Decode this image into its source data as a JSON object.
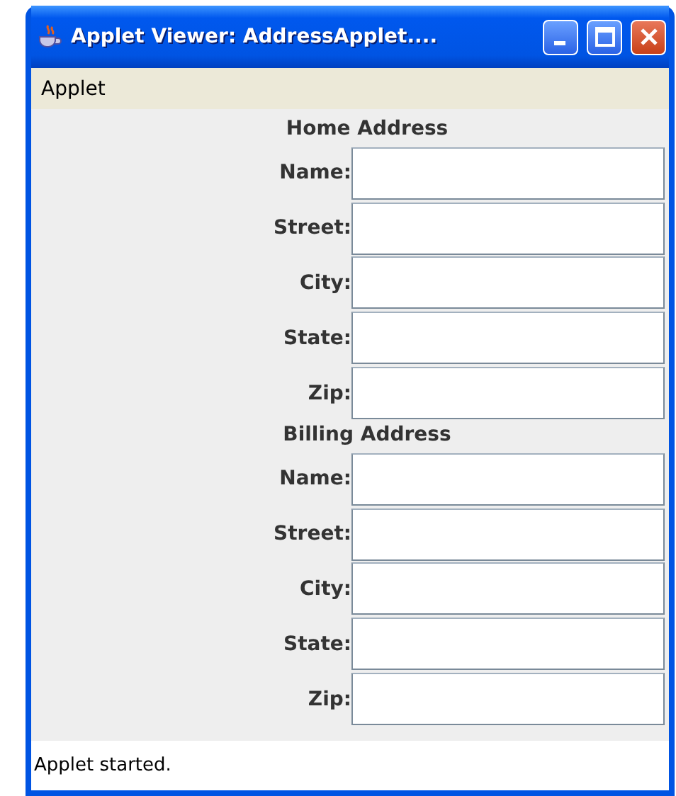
{
  "window": {
    "title": "Applet Viewer: AddressApplet...."
  },
  "menu_bar": [
    "Applet"
  ],
  "sections": [
    {
      "heading": "Home Address",
      "fields": [
        {
          "label": "Name:"
        },
        {
          "label": "Street:"
        },
        {
          "label": "City:"
        },
        {
          "label": "State:"
        },
        {
          "label": "Zip:"
        }
      ]
    },
    {
      "heading": "Billing Address",
      "fields": [
        {
          "label": "Name:"
        },
        {
          "label": "Street:"
        },
        {
          "label": "City:"
        },
        {
          "label": "State:"
        },
        {
          "label": "Zip:"
        }
      ]
    }
  ],
  "status_bar": "Applet started."
}
